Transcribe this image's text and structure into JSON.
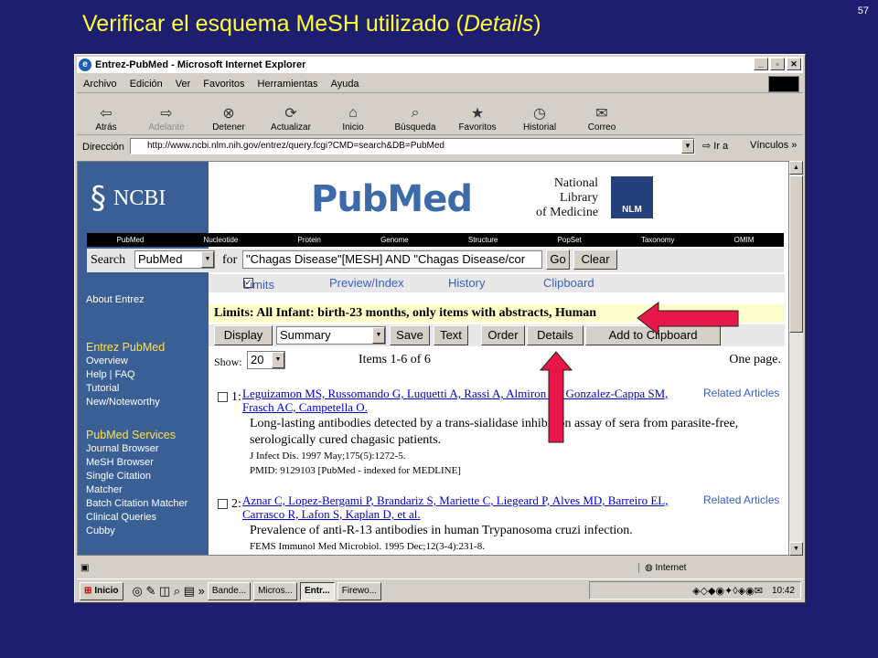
{
  "slide": {
    "title_main": "Verificar el esquema MeSH utilizado (",
    "title_italic": "Details",
    "title_end": ")",
    "number": "57"
  },
  "window": {
    "title": "Entrez-PubMed - Microsoft Internet Explorer"
  },
  "menu": [
    "Archivo",
    "Edición",
    "Ver",
    "Favoritos",
    "Herramientas",
    "Ayuda"
  ],
  "toolbar": [
    {
      "label": "Atrás",
      "icon": "back-arrow-icon",
      "glyph": "⇦"
    },
    {
      "label": "Adelante",
      "icon": "forward-arrow-icon",
      "glyph": "⇨",
      "disabled": true
    },
    {
      "label": "Detener",
      "icon": "stop-icon",
      "glyph": "⊗"
    },
    {
      "label": "Actualizar",
      "icon": "refresh-icon",
      "glyph": "⟳"
    },
    {
      "label": "Inicio",
      "icon": "home-icon",
      "glyph": "⌂"
    },
    {
      "label": "Búsqueda",
      "icon": "search-icon",
      "glyph": "⌕"
    },
    {
      "label": "Favoritos",
      "icon": "favorites-icon",
      "glyph": "★"
    },
    {
      "label": "Historial",
      "icon": "history-icon",
      "glyph": "◷"
    },
    {
      "label": "Correo",
      "icon": "mail-icon",
      "glyph": "✉"
    }
  ],
  "address": {
    "label": "Dirección",
    "url": "http://www.ncbi.nlm.nih.gov/entrez/query.fcgi?CMD=search&DB=PubMed",
    "go": "Ir a",
    "links": "Vínculos"
  },
  "page": {
    "ncbi": "NCBI",
    "pubmed_logo": "PubMed",
    "nlm": {
      "line1": "National",
      "line2": "Library",
      "line3": "of Medicine",
      "badge": "NLM"
    },
    "nav": [
      "PubMed",
      "Nucleotide",
      "Protein",
      "Genome",
      "Structure",
      "PopSet",
      "Taxonomy",
      "OMIM"
    ],
    "search": {
      "label": "Search",
      "db": "PubMed",
      "for": "for",
      "query": "\"Chagas Disease\"[MESH] AND \"Chagas Disease/cor",
      "go": "Go",
      "clear": "Clear"
    },
    "tabs": {
      "limits": "Limits",
      "preview": "Preview/Index",
      "history": "History",
      "clipboard": "Clipboard"
    },
    "limits_text": "Limits: All Infant: birth-23 months, only items with abstracts, Human",
    "display": {
      "button": "Display",
      "format": "Summary",
      "save": "Save",
      "text": "Text",
      "order": "Order",
      "details": "Details",
      "add": "Add to Clipboard"
    },
    "show": {
      "label": "Show:",
      "value": "20",
      "items": "Items 1-6 of 6",
      "pages": "One page."
    },
    "sidebar": {
      "about": "About Entrez",
      "entrez_head": "Entrez PubMed",
      "entrez_links": [
        "Overview",
        "Help | FAQ",
        "Tutorial",
        "New/Noteworthy"
      ],
      "services_head": "PubMed Services",
      "services_links": [
        "Journal Browser",
        "MeSH Browser",
        "Single Citation",
        "Matcher",
        "Batch Citation Matcher",
        "Clinical Queries",
        "Cubby"
      ]
    },
    "results": [
      {
        "num": "1:",
        "authors1": "Leguizamon MS, Russomando G, Luquetti A, Rassi A, Almiron M, Gonzalez-Cappa SM,",
        "authors2": "Frasch AC, Campetella O.",
        "title1": "Long-lasting antibodies detected by a trans-sialidase inhibition assay of sera from parasite-free,",
        "title2": "serologically cured chagasic patients.",
        "source": "J Infect Dis. 1997 May;175(5):1272-5.",
        "pmid": "PMID: 9129103 [PubMed - indexed for MEDLINE]",
        "related": "Related Articles"
      },
      {
        "num": "2:",
        "authors1": "Aznar C, Lopez-Bergami P, Brandariz S, Mariette C, Liegeard P, Alves MD, Barreiro EL,",
        "authors2": "Carrasco R, Lafon S, Kaplan D, et al.",
        "title1": "Prevalence of anti-R-13 antibodies in human Trypanosoma cruzi infection.",
        "source": "FEMS Immunol Med Microbiol. 1995 Dec;12(3-4):231-8.",
        "related": "Related Articles"
      }
    ]
  },
  "status": {
    "zone": "Internet"
  },
  "taskbar": {
    "start": "Inicio",
    "tasks": [
      "Bande...",
      "Micros...",
      "Entr...",
      "Firewo..."
    ],
    "clock": "10:42"
  },
  "colors": {
    "slide_bg": "#1d1f6e",
    "title": "#ffff33",
    "sidebar": "#3a5f94",
    "arrow": "#e8174a"
  }
}
